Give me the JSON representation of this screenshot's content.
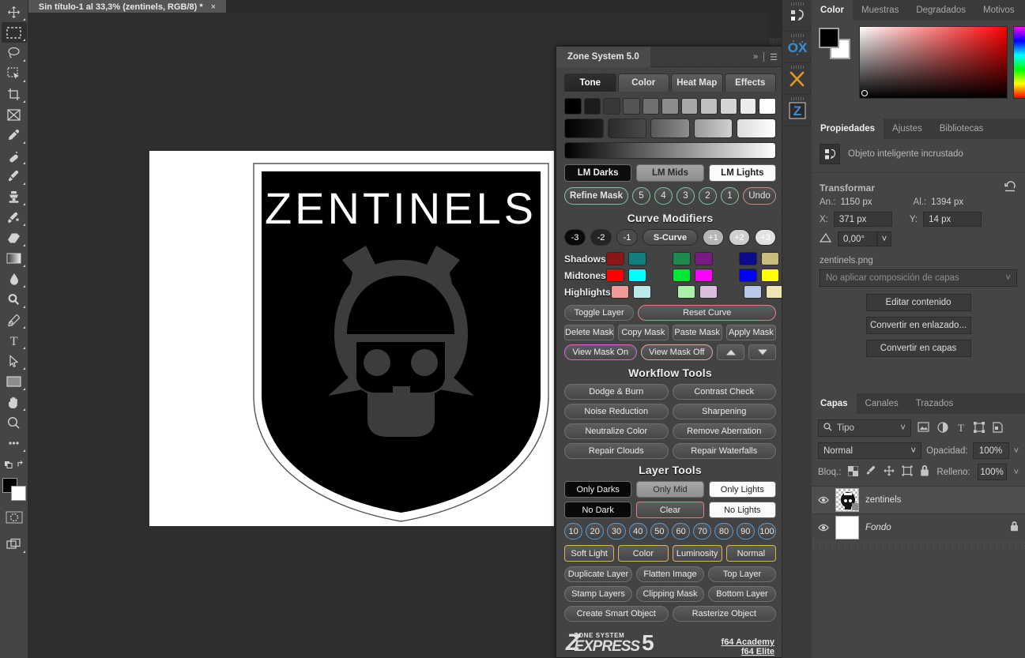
{
  "document": {
    "tab_title": "Sin título-1 al 33,3% (zentinels, RGB/8) *",
    "close_glyph": "×",
    "zoom_level": "33,3%",
    "color_mode": "RGB/8",
    "artwork_text": "ZENTINELS"
  },
  "toolbar": {
    "tools": [
      {
        "name": "move-tool",
        "label": "Mover"
      },
      {
        "name": "rectangular-marquee-tool",
        "label": "Marco rectangular"
      },
      {
        "name": "lasso-tool",
        "label": "Lazo"
      },
      {
        "name": "object-selection-tool",
        "label": "Selección de objetos"
      },
      {
        "name": "crop-tool",
        "label": "Recortar"
      },
      {
        "name": "frame-tool",
        "label": "Marco"
      },
      {
        "name": "eyedropper-tool",
        "label": "Cuentagotas"
      },
      {
        "name": "healing-brush-tool",
        "label": "Pincel corrector"
      },
      {
        "name": "brush-tool",
        "label": "Pincel"
      },
      {
        "name": "clone-stamp-tool",
        "label": "Tampón de clonar"
      },
      {
        "name": "history-brush-tool",
        "label": "Pincel de historia"
      },
      {
        "name": "eraser-tool",
        "label": "Borrador"
      },
      {
        "name": "gradient-tool",
        "label": "Degradado"
      },
      {
        "name": "blur-tool",
        "label": "Desenfocar"
      },
      {
        "name": "dodge-tool",
        "label": "Sobreexponer"
      },
      {
        "name": "pen-tool",
        "label": "Pluma"
      },
      {
        "name": "type-tool",
        "label": "Texto"
      },
      {
        "name": "path-selection-tool",
        "label": "Selección de trazado"
      },
      {
        "name": "rectangle-tool",
        "label": "Rectángulo"
      },
      {
        "name": "hand-tool",
        "label": "Mano"
      },
      {
        "name": "zoom-tool",
        "label": "Zoom"
      },
      {
        "name": "edit-toolbar-tool",
        "label": "Editar barra de herramientas"
      }
    ],
    "foreground_color": "#000000",
    "background_color": "#ffffff"
  },
  "rail": {
    "items": [
      {
        "name": "history-icon",
        "label": "Historia"
      },
      {
        "name": "retouch-extension-icon",
        "label": "Retoque"
      },
      {
        "name": "tools-extension-icon",
        "label": "Herramientas"
      },
      {
        "name": "zone-system-icon",
        "label": "Zone System"
      }
    ]
  },
  "zone_system": {
    "title": "Zone System 5.0",
    "header_icons": [
      "collapse-icon",
      "menu-icon"
    ],
    "tabs": [
      {
        "label": "Tone",
        "active": true
      },
      {
        "label": "Color",
        "active": false
      },
      {
        "label": "Heat Map",
        "active": false
      },
      {
        "label": "Effects",
        "active": false
      }
    ],
    "zone_swatches": [
      "#000000",
      "#1c1c1c",
      "#383838",
      "#545454",
      "#707070",
      "#8c8c8c",
      "#a8a8a8",
      "#c0c0c0",
      "#d4d4d4",
      "#ececec",
      "#ffffff"
    ],
    "zone_gradients": [
      {
        "from": "#000000",
        "to": "#1e1e1e"
      },
      {
        "from": "#2a2a2a",
        "to": "#4a4a4a"
      },
      {
        "from": "#585858",
        "to": "#8e8e8e"
      },
      {
        "from": "#9a9a9a",
        "to": "#d0d0d0"
      },
      {
        "from": "#dcdcdc",
        "to": "#ffffff"
      }
    ],
    "lm_buttons": [
      {
        "label": "LM Darks",
        "style": "dark"
      },
      {
        "label": "LM Mids",
        "style": "mid"
      },
      {
        "label": "LM Lights",
        "style": "light"
      }
    ],
    "refine_row": {
      "refine_label": "Refine Mask",
      "numbers": [
        "5",
        "4",
        "3",
        "2",
        "1"
      ],
      "undo_label": "Undo"
    },
    "curve_modifiers": {
      "title": "Curve Modifiers",
      "buttons": [
        "-3",
        "-2",
        "-1",
        "S-Curve",
        "+1",
        "+2",
        "+3"
      ]
    },
    "tone_rows": [
      {
        "label": "Shadows",
        "colors": [
          "#8b1616",
          "#117f7f",
          "",
          "#1e8a4e",
          "#7a1b84",
          "",
          "#0b0b8c",
          "#c9bd7d"
        ]
      },
      {
        "label": "Midtones",
        "colors": [
          "#ff0000",
          "#00ffff",
          "",
          "#00e832",
          "#ff00ff",
          "",
          "#0000ff",
          "#ffff00"
        ]
      },
      {
        "label": "Highlights",
        "colors": [
          "#f09a9a",
          "#bde9ea",
          "",
          "#abf0ab",
          "#d9bede",
          "",
          "#b9c8e8",
          "#efe4b4"
        ]
      }
    ],
    "mask_buttons": {
      "toggle_layer": "Toggle Layer",
      "reset_curve": "Reset Curve",
      "delete_mask": "Delete Mask",
      "copy_mask": "Copy Mask",
      "paste_mask": "Paste Mask",
      "apply_mask": "Apply Mask",
      "view_mask_on": "View Mask On",
      "view_mask_off": "View Mask Off",
      "up_arrow": "up-arrow-icon",
      "down_arrow": "down-arrow-icon"
    },
    "workflow_tools": {
      "title": "Workflow Tools",
      "buttons": [
        "Dodge & Burn",
        "Contrast Check",
        "Noise Reduction",
        "Sharpening",
        "Neutralize Color",
        "Remove Aberration",
        "Repair Clouds",
        "Repair Waterfalls"
      ]
    },
    "layer_tools": {
      "title": "Layer Tools",
      "row1": [
        {
          "label": "Only Darks",
          "style": "dark"
        },
        {
          "label": "Only Mid",
          "style": "mid"
        },
        {
          "label": "Only Lights",
          "style": "light"
        }
      ],
      "row2": [
        {
          "label": "No Dark",
          "style": "dark"
        },
        {
          "label": "Clear",
          "style": "clear"
        },
        {
          "label": "No Lights",
          "style": "light"
        }
      ],
      "opacities": [
        "10",
        "20",
        "30",
        "40",
        "50",
        "60",
        "70",
        "80",
        "90",
        "100"
      ],
      "blend_modes": [
        "Soft Light",
        "Color",
        "Luminosity",
        "Normal"
      ],
      "actions": [
        "Duplicate Layer",
        "Flatten Image",
        "Top Layer",
        "Stamp Layers",
        "Clipping Mask",
        "Bottom Layer"
      ],
      "object_actions": [
        "Create Smart Object",
        "Rasterize Object"
      ]
    },
    "footer": {
      "logo_z": "Z",
      "logo_small": "ZONE SYSTEM",
      "logo_express": "EXPRESS",
      "logo_number": "5",
      "links": [
        "f64 Academy",
        "f64 Elite"
      ]
    }
  },
  "color_panel": {
    "tabs": [
      {
        "label": "Color",
        "active": true
      },
      {
        "label": "Muestras",
        "active": false
      },
      {
        "label": "Degradados",
        "active": false
      },
      {
        "label": "Motivos",
        "active": false
      }
    ],
    "foreground": "#000000",
    "background": "#ffffff"
  },
  "properties_panel": {
    "tabs": [
      {
        "label": "Propiedades",
        "active": true
      },
      {
        "label": "Ajustes",
        "active": false
      },
      {
        "label": "Bibliotecas",
        "active": false
      }
    ],
    "object_type": "Objeto inteligente incrustado",
    "transform": {
      "title": "Transformar",
      "reset_icon": "reset-icon",
      "width_label": "An.:",
      "width_value": "1150 px",
      "height_label": "Al.:",
      "height_value": "1394 px",
      "x_label": "X:",
      "x_value": "371 px",
      "y_label": "Y:",
      "y_value": "14 px",
      "angle_icon": "angle-icon",
      "angle_value": "0,00°"
    },
    "filename": "zentinels.png",
    "layer_comp": "No aplicar composición de capas",
    "buttons": [
      "Editar contenido",
      "Convertir en enlazado...",
      "Convertir en capas"
    ]
  },
  "layers_panel": {
    "tabs": [
      {
        "label": "Capas",
        "active": true
      },
      {
        "label": "Canales",
        "active": false
      },
      {
        "label": "Trazados",
        "active": false
      }
    ],
    "filter_label": "Tipo",
    "filter_icons": [
      "image-filter-icon",
      "adjustment-filter-icon",
      "type-filter-icon",
      "shape-filter-icon",
      "smart-object-filter-icon"
    ],
    "blend_mode": "Normal",
    "opacity_label": "Opacidad:",
    "opacity_value": "100%",
    "lock_label": "Bloq.:",
    "lock_icons": [
      "lock-transparent-icon",
      "lock-image-icon",
      "lock-position-icon",
      "lock-nesting-icon",
      "lock-all-icon"
    ],
    "fill_label": "Relleno:",
    "fill_value": "100%",
    "layers": [
      {
        "name": "zentinels",
        "visible": true,
        "selected": true,
        "italic": false,
        "locked": false
      },
      {
        "name": "Fondo",
        "visible": true,
        "selected": false,
        "italic": true,
        "locked": true
      }
    ]
  }
}
